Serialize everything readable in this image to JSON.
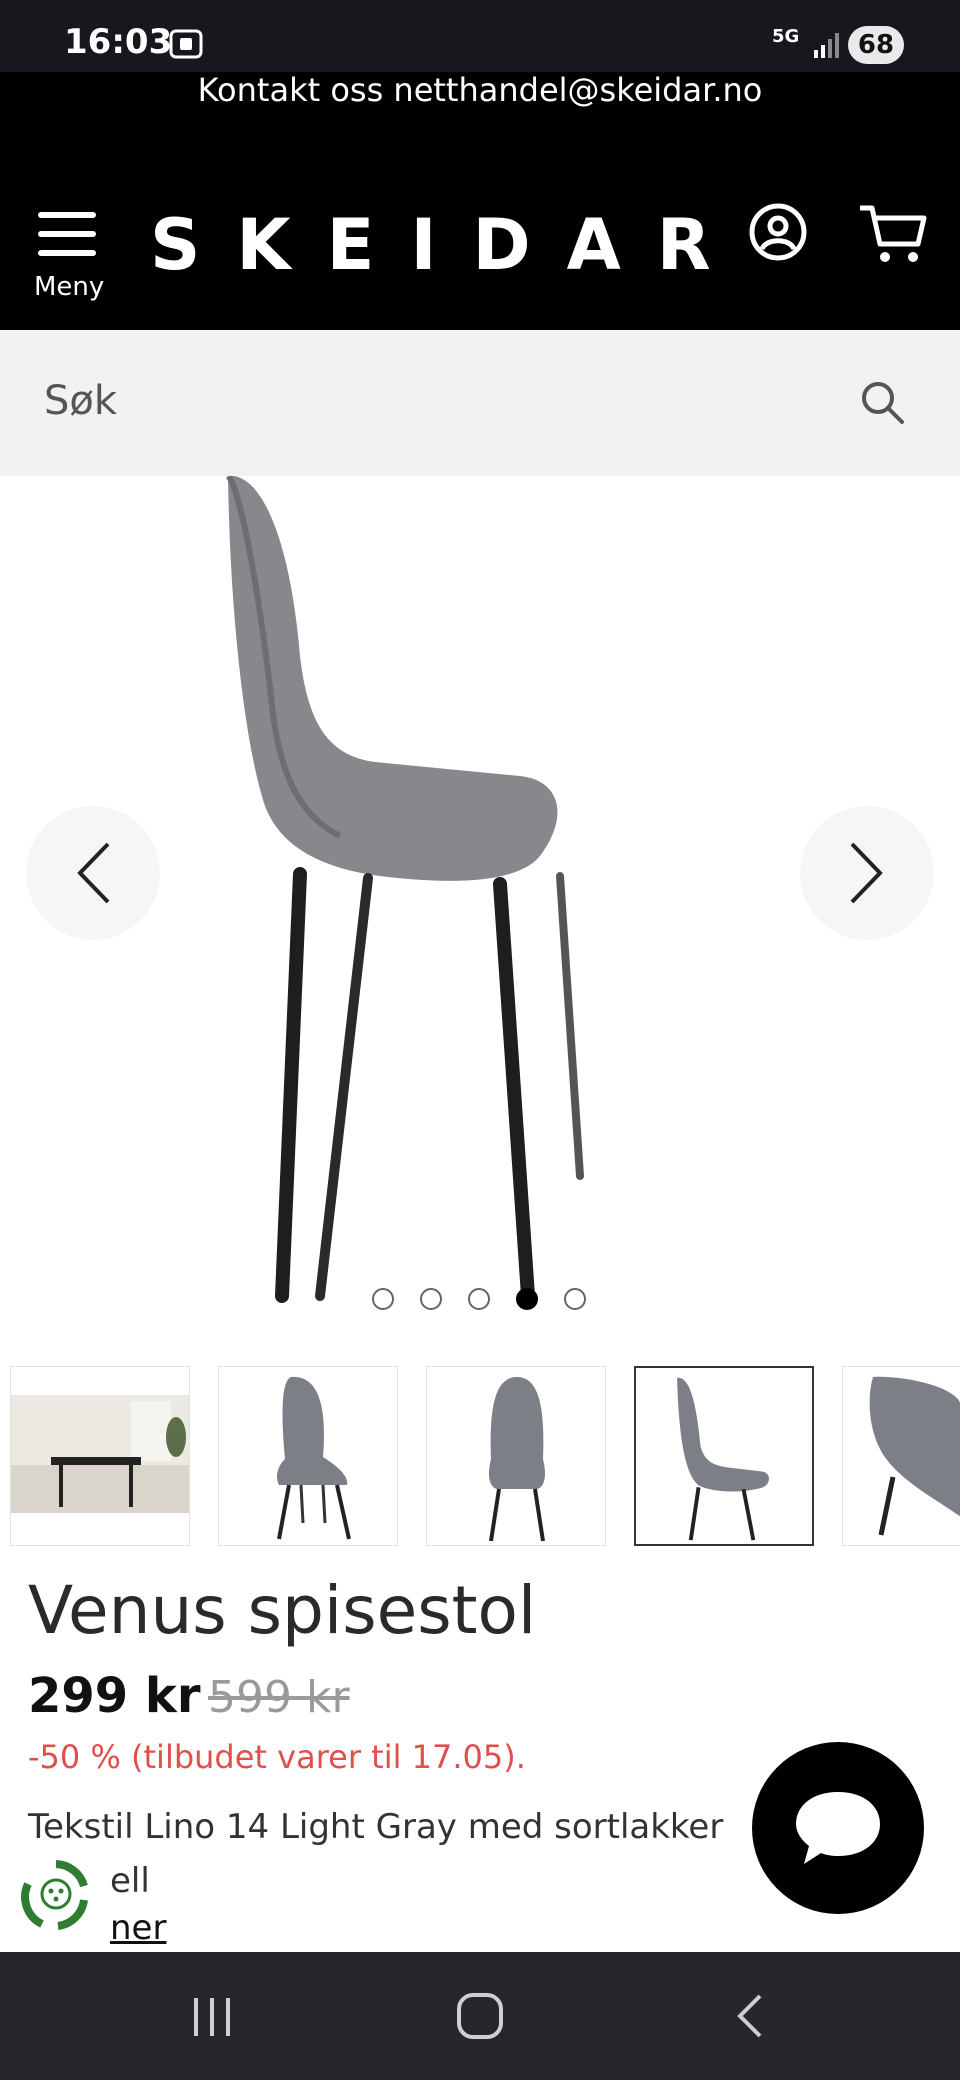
{
  "status_bar": {
    "time": "16:03",
    "network": "5G",
    "battery": "68"
  },
  "header": {
    "contact": "Kontakt oss netthandel@skeidar.no",
    "menu_label": "Meny",
    "logo": "SKEIDAR"
  },
  "search": {
    "placeholder": "Søk"
  },
  "gallery": {
    "dots_count": 5,
    "active_dot": 4,
    "thumbnails": [
      "room-scene",
      "chair-front",
      "chair-front-2",
      "chair-side",
      "chair-detail"
    ],
    "selected_thumbnail": 4
  },
  "product": {
    "title": "Venus spisestol",
    "price": "299 kr",
    "old_price": "599 kr",
    "discount": "-50 % (tilbudet varer til 17.05).",
    "description_line1": "Tekstil Lino 14 Light Gray med sortlakker",
    "description_line2": "ell",
    "more_link": "ner"
  },
  "colors": {
    "header_bg": "#000000",
    "discount": "#e0504a",
    "search_bg": "#f2f2f2",
    "eco_green": "#2e7d32"
  }
}
